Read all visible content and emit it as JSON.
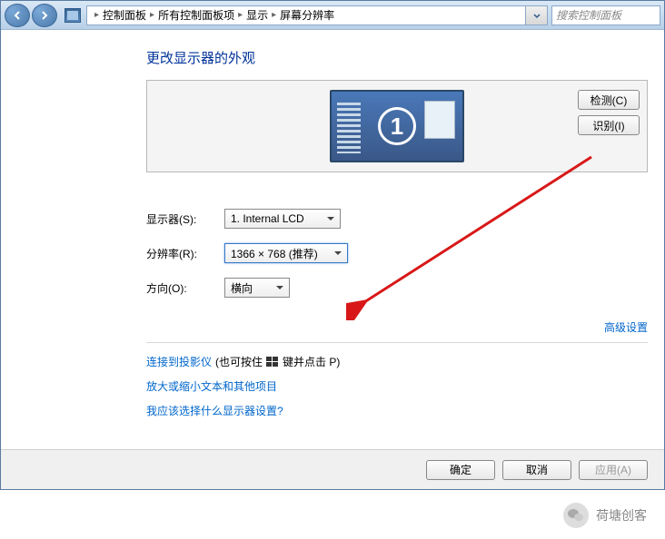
{
  "breadcrumb": {
    "items": [
      "控制面板",
      "所有控制面板项",
      "显示",
      "屏幕分辨率"
    ]
  },
  "search": {
    "placeholder": "搜索控制面板"
  },
  "page": {
    "title": "更改显示器的外观"
  },
  "preview": {
    "monitor_number": "1",
    "detect_button": "检测(C)",
    "identify_button": "识别(I)"
  },
  "form": {
    "display_label": "显示器(S):",
    "display_value": "1. Internal LCD",
    "resolution_label": "分辨率(R):",
    "resolution_value": "1366 × 768 (推荐)",
    "orientation_label": "方向(O):",
    "orientation_value": "横向"
  },
  "links": {
    "advanced": "高级设置",
    "projector_prefix": "连接到投影仪",
    "projector_hint_a": "(也可按住",
    "projector_hint_b": "键并点击 P)",
    "enlarge": "放大或缩小文本和其他项目",
    "help": "我应该选择什么显示器设置?"
  },
  "buttons": {
    "ok": "确定",
    "cancel": "取消",
    "apply": "应用(A)"
  },
  "watermark": {
    "text": "荷塘创客"
  }
}
